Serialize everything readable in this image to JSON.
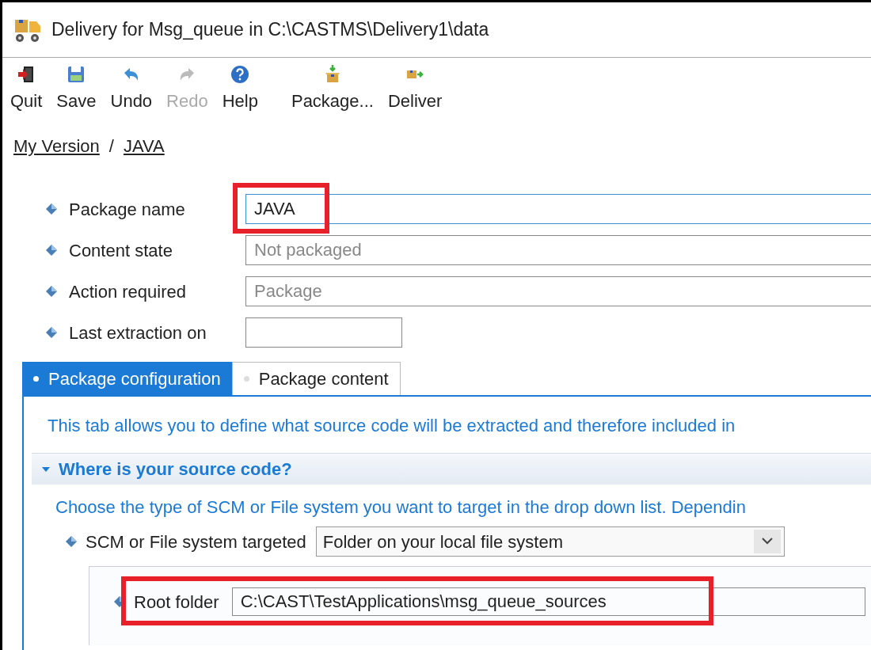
{
  "window": {
    "title": "Delivery for Msg_queue in C:\\CASTMS\\Delivery1\\data"
  },
  "toolbar": [
    {
      "label": "Quit",
      "kind": "quit",
      "disabled": false
    },
    {
      "label": "Save",
      "kind": "save",
      "disabled": false
    },
    {
      "label": "Undo",
      "kind": "undo",
      "disabled": false
    },
    {
      "label": "Redo",
      "kind": "redo",
      "disabled": true
    },
    {
      "label": "Help",
      "kind": "help",
      "disabled": false
    },
    {
      "label": "Package...",
      "kind": "package",
      "disabled": false
    },
    {
      "label": "Deliver",
      "kind": "deliver",
      "disabled": false
    }
  ],
  "breadcrumb": {
    "items": [
      "My Version",
      "JAVA"
    ],
    "separator": "/"
  },
  "fields": [
    {
      "label": "Package name",
      "value": "JAVA",
      "focused": true,
      "highlighted": true,
      "kind": "wide"
    },
    {
      "label": "Content state",
      "value": "Not packaged",
      "focused": false,
      "highlighted": false,
      "kind": "wide"
    },
    {
      "label": "Action required",
      "value": "Package",
      "focused": false,
      "highlighted": false,
      "kind": "wide"
    },
    {
      "label": "Last extraction on",
      "focused": false,
      "highlighted": false,
      "kind": "short"
    }
  ],
  "tabs": [
    {
      "label": "Package configuration",
      "selected": true
    },
    {
      "label": "Package content",
      "selected": false
    }
  ],
  "panel": {
    "description": "This tab allows you to define what source code will be extracted and therefore included in",
    "section": {
      "title": "Where is your source code?",
      "expanded": true,
      "hint": "Choose the type of SCM or File system you want to target in the drop down list. Dependin",
      "scm": {
        "label": "SCM or File system targeted",
        "value": "Folder on your local file system"
      },
      "root": {
        "label": "Root folder",
        "value": "C:\\CAST\\TestApplications\\msg_queue_sources",
        "highlighted": true
      }
    }
  }
}
